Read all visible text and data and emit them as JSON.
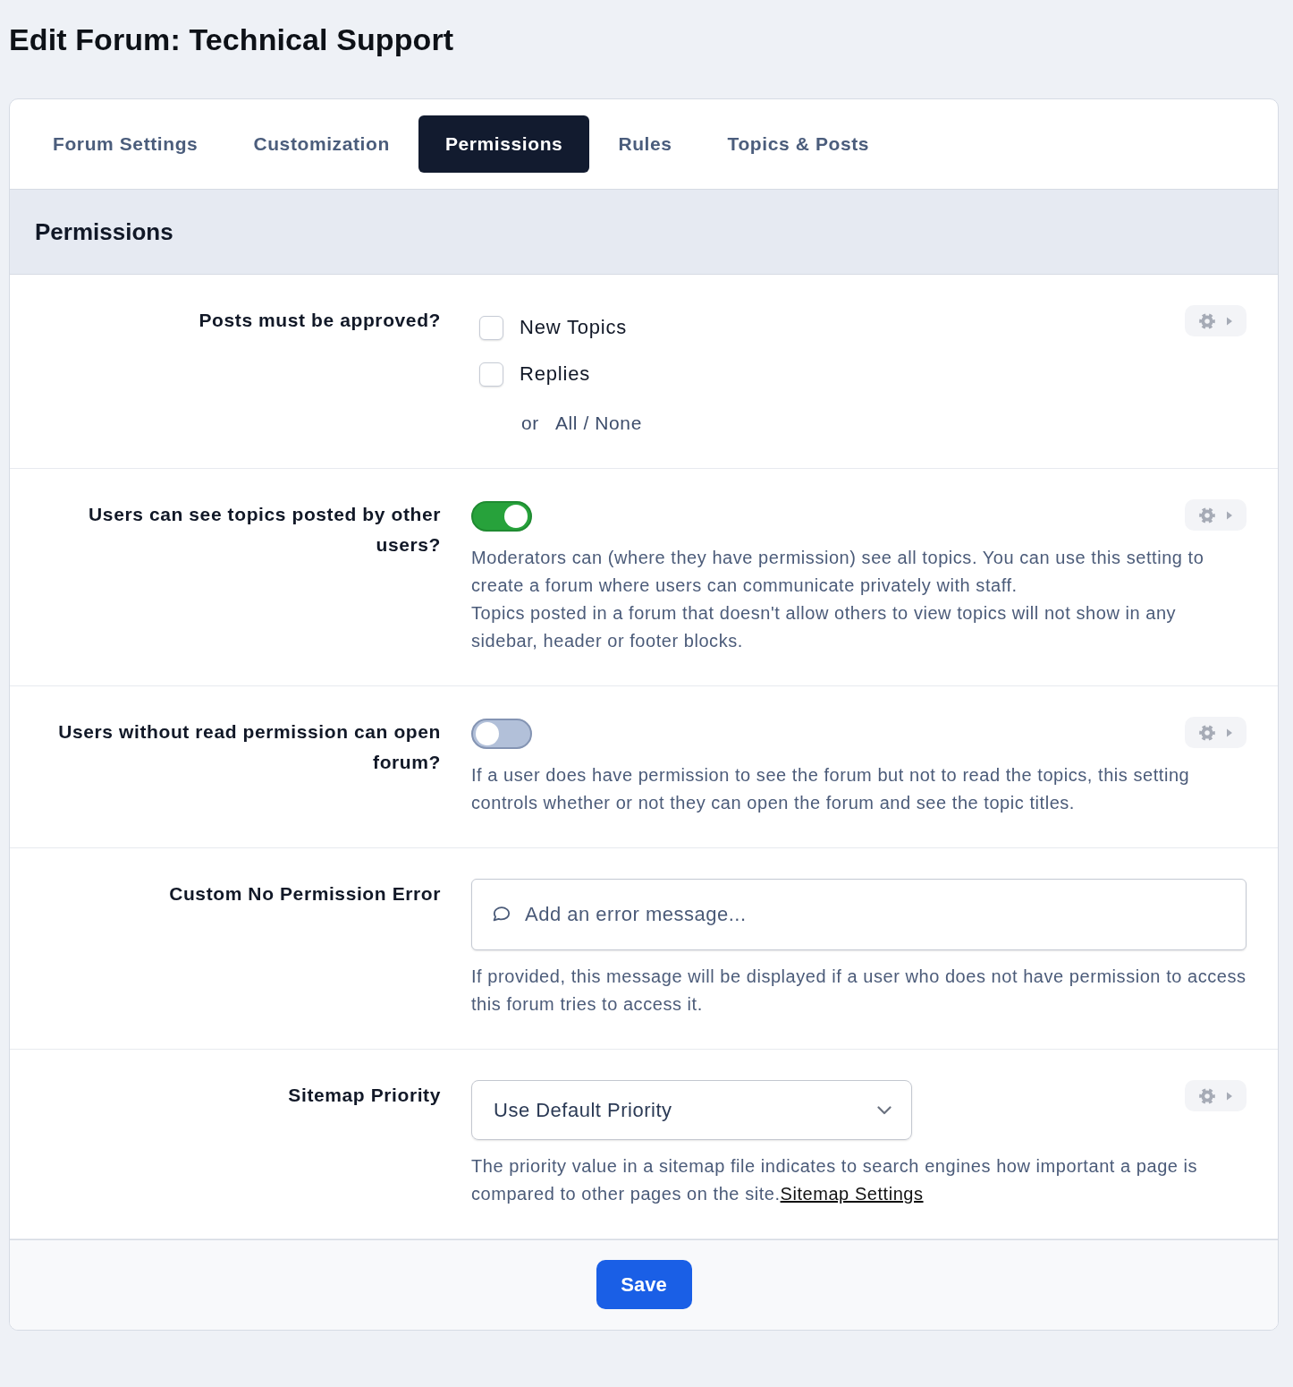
{
  "page": {
    "title": "Edit Forum: Technical Support"
  },
  "tabs": [
    {
      "label": "Forum Settings",
      "selected": false
    },
    {
      "label": "Customization",
      "selected": false
    },
    {
      "label": "Permissions",
      "selected": true
    },
    {
      "label": "Rules",
      "selected": false
    },
    {
      "label": "Topics & Posts",
      "selected": false
    }
  ],
  "section": {
    "title": "Permissions"
  },
  "settings": [
    {
      "kind": "checkboxes",
      "label": "Posts must be approved?",
      "menu_button": true,
      "options": [
        {
          "label": "New Topics",
          "checked": false
        },
        {
          "label": "Replies",
          "checked": false
        }
      ],
      "or_text": "or",
      "all_none_link": "All / None"
    },
    {
      "kind": "toggle",
      "label": "Users can see topics posted by other users?",
      "menu_button": true,
      "on": true,
      "description": [
        "Moderators can (where they have permission) see all topics. You can use this setting to create a forum where users can communicate privately with staff.",
        "Topics posted in a forum that doesn't allow others to view topics will not show in any sidebar, header or footer blocks."
      ]
    },
    {
      "kind": "toggle",
      "label": "Users without read permission can open forum?",
      "menu_button": true,
      "on": false,
      "description": [
        "If a user does have permission to see the forum but not to read the topics, this setting controls whether or not they can open the forum and see the topic titles."
      ]
    },
    {
      "kind": "text_field",
      "label": "Custom No Permission Error",
      "menu_button": false,
      "placeholder": "Add an error message...",
      "description": [
        "If provided, this message will be displayed if a user who does not have permission to access this forum tries to access it."
      ]
    },
    {
      "kind": "select",
      "label": "Sitemap Priority",
      "menu_button": true,
      "value": "Use Default Priority",
      "description": [
        "The priority value in a sitemap file indicates to search engines how important a page is compared to other pages on the site."
      ],
      "link": "Sitemap Settings"
    }
  ],
  "footer": {
    "save_button": "Save"
  }
}
